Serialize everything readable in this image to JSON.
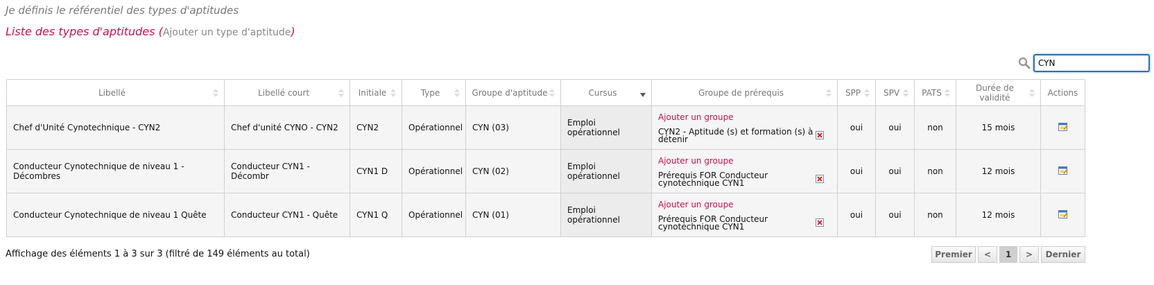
{
  "header": {
    "subtitle": "Je définis le référentiel des types d'aptitudes",
    "list_title": "Liste des types d'aptitudes",
    "paren_open": "(",
    "add_link": "Ajouter un type d'aptitude",
    "paren_close": ")"
  },
  "search": {
    "value": "CYN",
    "icon": "search-icon"
  },
  "table": {
    "columns": [
      "Libellé",
      "Libellé court",
      "Initiale",
      "Type",
      "Groupe d'aptitude",
      "Cursus",
      "Groupe de prérequis",
      "SPP",
      "SPV",
      "PATS",
      "Durée de validité",
      "Actions"
    ],
    "rows": [
      {
        "libelle": "Chef d'Unité Cynotechnique - CYN2",
        "libelle_court": "Chef d'unité CYNO - CYN2",
        "initiale": "CYN2",
        "type": "Opérationnel",
        "groupe_aptitude": "CYN (03)",
        "cursus": "Emploi opérationnel",
        "add_group": "Ajouter un groupe",
        "prerequis": "CYN2 - Aptitude (s) et formation (s) à détenir",
        "spp": "oui",
        "spv": "oui",
        "pats": "non",
        "duree": "15 mois"
      },
      {
        "libelle": "Conducteur Cynotechnique de niveau 1 - Décombres",
        "libelle_court": "Conducteur CYN1 - Décombr",
        "initiale": "CYN1 D",
        "type": "Opérationnel",
        "groupe_aptitude": "CYN (02)",
        "cursus": "Emploi opérationnel",
        "add_group": "Ajouter un groupe",
        "prerequis": "Prérequis FOR Conducteur cynotechnique CYN1",
        "spp": "oui",
        "spv": "oui",
        "pats": "non",
        "duree": "12 mois"
      },
      {
        "libelle": "Conducteur Cynotechnique de niveau 1 Quête",
        "libelle_court": "Conducteur CYN1 - Quête",
        "initiale": "CYN1 Q",
        "type": "Opérationnel",
        "groupe_aptitude": "CYN (01)",
        "cursus": "Emploi opérationnel",
        "add_group": "Ajouter un groupe",
        "prerequis": "Prérequis FOR Conducteur cynotechnique CYN1",
        "spp": "oui",
        "spv": "oui",
        "pats": "non",
        "duree": "12 mois"
      }
    ]
  },
  "footer": {
    "info": "Affichage des éléments 1 à 3 sur 3 (filtré de 149 éléments au total)",
    "pager": {
      "first": "Premier",
      "prev": "<",
      "page": "1",
      "next": ">",
      "last": "Dernier"
    }
  },
  "colors": {
    "accent": "#c8104f",
    "focus": "#2f6fb3",
    "delete": "#d6262a"
  }
}
